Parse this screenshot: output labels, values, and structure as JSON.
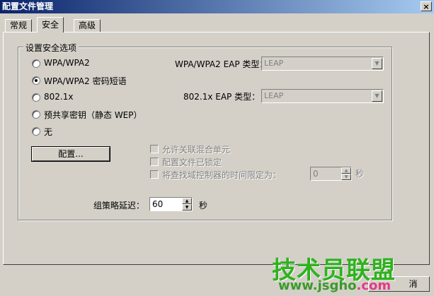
{
  "window": {
    "title": "配置文件管理",
    "close_glyph": "×"
  },
  "tabs": [
    {
      "label": "常规",
      "active": false
    },
    {
      "label": "安全",
      "active": true
    },
    {
      "label": "高级",
      "active": false
    }
  ],
  "security": {
    "group_title": "设置安全选项",
    "options": [
      {
        "label": "WPA/WPA2",
        "selected": false
      },
      {
        "label": "WPA/WPA2 密码短语",
        "selected": true
      },
      {
        "label": "802.1x",
        "selected": false
      },
      {
        "label": "预共享密钥（静态 WEP）",
        "selected": false
      },
      {
        "label": "无",
        "selected": false
      }
    ],
    "wpa_eap_label": "WPA/WPA2 EAP 类型：",
    "wpa_eap_value": "LEAP",
    "dot1x_eap_label": "802.1x EAP 类型：",
    "dot1x_eap_value": "LEAP",
    "configure_button": "配置...",
    "checkboxes": [
      {
        "label": "允许关联混合单元",
        "checked": false
      },
      {
        "label": "配置文件已锁定",
        "checked": false
      },
      {
        "label": "将查找域控制器的时间限定为：",
        "checked": false
      }
    ],
    "dc_timeout_value": "0",
    "dc_timeout_unit": "秒",
    "group_policy_label": "组策略延迟：",
    "group_policy_value": "60",
    "group_policy_unit": "秒"
  },
  "footer": {
    "cancel_label_partial": "消"
  },
  "watermark": {
    "text": "技术员联盟",
    "url_main": "www.jsgho",
    "url_tld": ".com"
  }
}
